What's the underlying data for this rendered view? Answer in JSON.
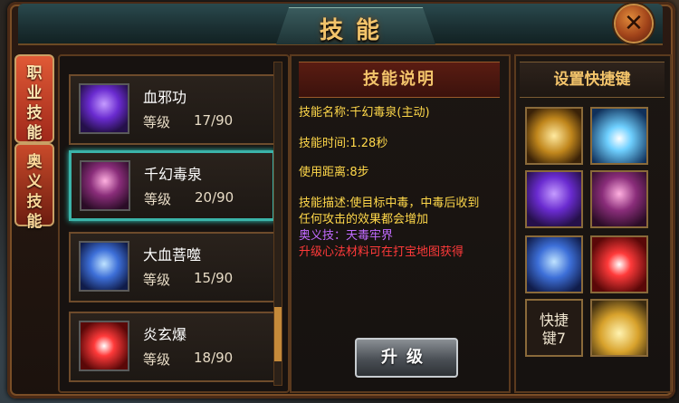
{
  "window": {
    "title": "技能",
    "close_label": "✕"
  },
  "background": {
    "numbers": [
      "92",
      "571"
    ]
  },
  "side_tabs": [
    {
      "label": "职业技能",
      "lines": [
        "职",
        "业",
        "技",
        "能"
      ],
      "active": true
    },
    {
      "label": "奥义技能",
      "lines": [
        "奥",
        "义",
        "技",
        "能"
      ],
      "active": false
    }
  ],
  "skills": [
    {
      "name": "血邪功",
      "level_label": "等级",
      "level": "17/90",
      "icon": "purple-spirit-icon",
      "selected": false
    },
    {
      "name": "千幻毒泉",
      "level_label": "等级",
      "level": "20/90",
      "icon": "poison-skull-icon",
      "selected": true
    },
    {
      "name": "大血菩噬",
      "level_label": "等级",
      "level": "15/90",
      "icon": "blue-figures-icon",
      "selected": false
    },
    {
      "name": "炎玄爆",
      "level_label": "等级",
      "level": "18/90",
      "icon": "red-slash-icon",
      "selected": false
    }
  ],
  "description": {
    "header": "技能说明",
    "name_line": "技能名称:千幻毒泉(主动)",
    "time_line": "技能时间:1.28秒",
    "range_line": "使用距离:8步",
    "desc_line1": "技能描述:使目标中毒，中毒后收到",
    "desc_line2": "任何攻击的效果都会增加",
    "ultimate_line": "奥义技：天毒牢界",
    "upgrade_hint": "升级心法材料可在打宝地图获得"
  },
  "upgrade_button": "升级",
  "shortcut": {
    "header": "设置快捷键",
    "slots": [
      {
        "icon": "golden-warrior-icon"
      },
      {
        "icon": "lightning-icon"
      },
      {
        "icon": "purple-spirit-icon"
      },
      {
        "icon": "poison-skull-icon"
      },
      {
        "icon": "blue-figures-icon"
      },
      {
        "icon": "red-slash-icon"
      },
      {
        "label": "快捷键7"
      },
      {
        "icon": "potion-stack-icon"
      }
    ],
    "slot7_lines": [
      "快捷",
      "键7"
    ]
  },
  "colors": {
    "accent_gold": "#f3c46b",
    "selected_border": "#3bb3a9",
    "field_yellow": "#ffd84a",
    "ultimate_purple": "#c26bff",
    "hint_red": "#ff3a3a"
  }
}
